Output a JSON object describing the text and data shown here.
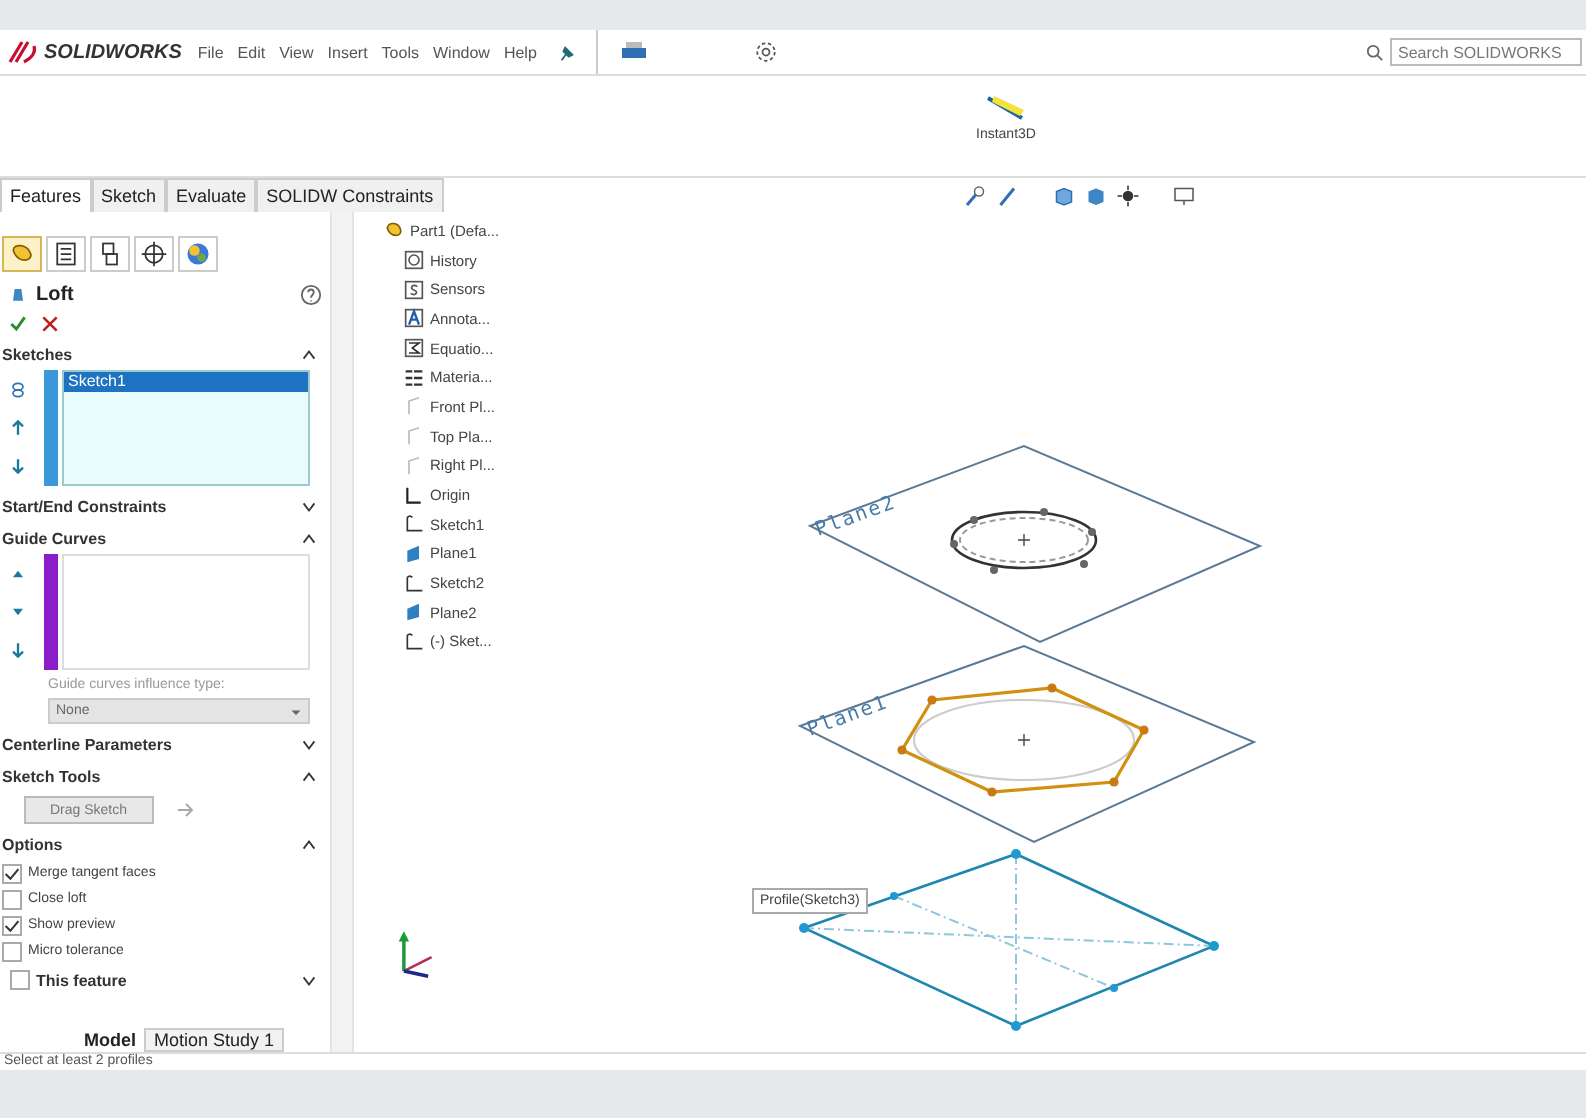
{
  "app": {
    "logo": "SOLIDWORKS",
    "menu": [
      "File",
      "Edit",
      "View",
      "Insert",
      "Tools",
      "Window",
      "Help"
    ],
    "search": {
      "placeholder": "Search SOLIDWORKS"
    }
  },
  "ribbon": {
    "buttons": [
      "Instant3D"
    ]
  },
  "command_tabs": [
    {
      "label": "Features",
      "selected": true
    },
    {
      "label": "Sketch",
      "selected": false
    },
    {
      "label": "Evaluate",
      "selected": false
    },
    {
      "label": "SOLIDW Constraints",
      "selected": false
    }
  ],
  "panel_tabs": [
    {
      "kind": "feature",
      "selected": true
    },
    {
      "kind": "property",
      "selected": false
    },
    {
      "kind": "config",
      "selected": false
    },
    {
      "kind": "dim",
      "selected": false
    },
    {
      "kind": "display",
      "selected": false
    }
  ],
  "loft": {
    "title": "Loft",
    "profiles": {
      "header": "Sketches",
      "expanded": true,
      "items": [
        {
          "label": "Sketch1",
          "selected": true
        }
      ]
    },
    "start_end": {
      "header": "Start/End Constraints",
      "expanded": false
    },
    "guide_curves": {
      "header": "Guide Curves",
      "expanded": true,
      "influence_label": "Guide curves influence type:",
      "influence_value": "None"
    },
    "centerline": {
      "header": "Centerline Parameters",
      "expanded": false
    },
    "sketch_tools": {
      "header": "Sketch Tools",
      "expanded": true,
      "button": "Drag Sketch"
    },
    "options": {
      "header": "Options",
      "expanded": true,
      "checks": [
        {
          "label": "Merge tangent faces",
          "checked": true
        },
        {
          "label": "Close loft",
          "checked": false
        },
        {
          "label": "Show preview",
          "checked": true
        },
        {
          "label": "Micro tolerance",
          "checked": false
        }
      ]
    },
    "feature_scope": {
      "label": "This feature",
      "checked": false,
      "expanded": false
    }
  },
  "tree": {
    "root": "Part1 (Defa...",
    "items": [
      {
        "label": "History",
        "kind": "history"
      },
      {
        "label": "Sensors",
        "kind": "sensor"
      },
      {
        "label": "Annota...",
        "kind": "annotation"
      },
      {
        "label": "Equatio...",
        "kind": "equation"
      },
      {
        "label": "Materia...",
        "kind": "material"
      },
      {
        "label": "Front Pl...",
        "kind": "plane"
      },
      {
        "label": "Top Pla...",
        "kind": "plane"
      },
      {
        "label": "Right Pl...",
        "kind": "plane"
      },
      {
        "label": "Origin",
        "kind": "origin"
      },
      {
        "label": "Sketch1",
        "kind": "sketch"
      },
      {
        "label": "Plane1",
        "kind": "plane_solid"
      },
      {
        "label": "Sketch2",
        "kind": "sketch"
      },
      {
        "label": "Plane2",
        "kind": "plane_solid"
      },
      {
        "label": "(-) Sket...",
        "kind": "sketch"
      }
    ]
  },
  "viewport": {
    "planes": [
      "Plane2",
      "Plane1"
    ],
    "tooltip": "Profile(Sketch3)"
  },
  "bottom_tabs": [
    {
      "label": "Model",
      "selected": true
    },
    {
      "label": "Motion Study 1",
      "selected": false
    }
  ],
  "status_bar": {
    "message": "Select at least 2 profiles"
  }
}
